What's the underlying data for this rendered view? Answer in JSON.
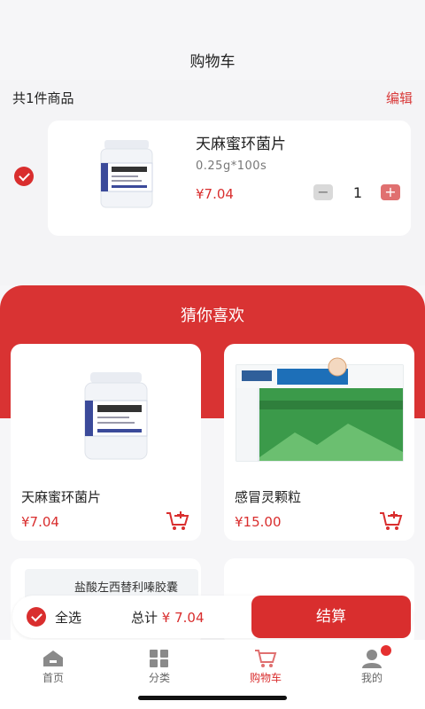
{
  "header": {
    "title": "购物车"
  },
  "summary": {
    "count_label": "共1件商品",
    "edit_label": "编辑"
  },
  "cart": {
    "item": {
      "name": "天麻蜜环菌片",
      "spec": "0.25g*100s",
      "price": "¥7.04",
      "quantity": "1",
      "minus": "−",
      "plus": "+",
      "checked": true
    }
  },
  "recommend": {
    "title": "猜你喜欢",
    "products": [
      {
        "name": "天麻蜜环菌片",
        "price": "¥7.04"
      },
      {
        "name": "感冒灵颗粒",
        "price": "¥15.00"
      }
    ],
    "partial_product_label": "盐酸左西替利嗪胶囊"
  },
  "bottom": {
    "select_all": "全选",
    "total_label": "总计",
    "total_value": "¥ 7.04",
    "checkout": "结算"
  },
  "tabs": [
    {
      "label": "首页",
      "icon": "home-icon"
    },
    {
      "label": "分类",
      "icon": "category-icon"
    },
    {
      "label": "购物车",
      "icon": "cart-icon"
    },
    {
      "label": "我的",
      "icon": "profile-icon"
    }
  ],
  "colors": {
    "accent": "#d92e2e",
    "background": "#f4f4f6"
  }
}
